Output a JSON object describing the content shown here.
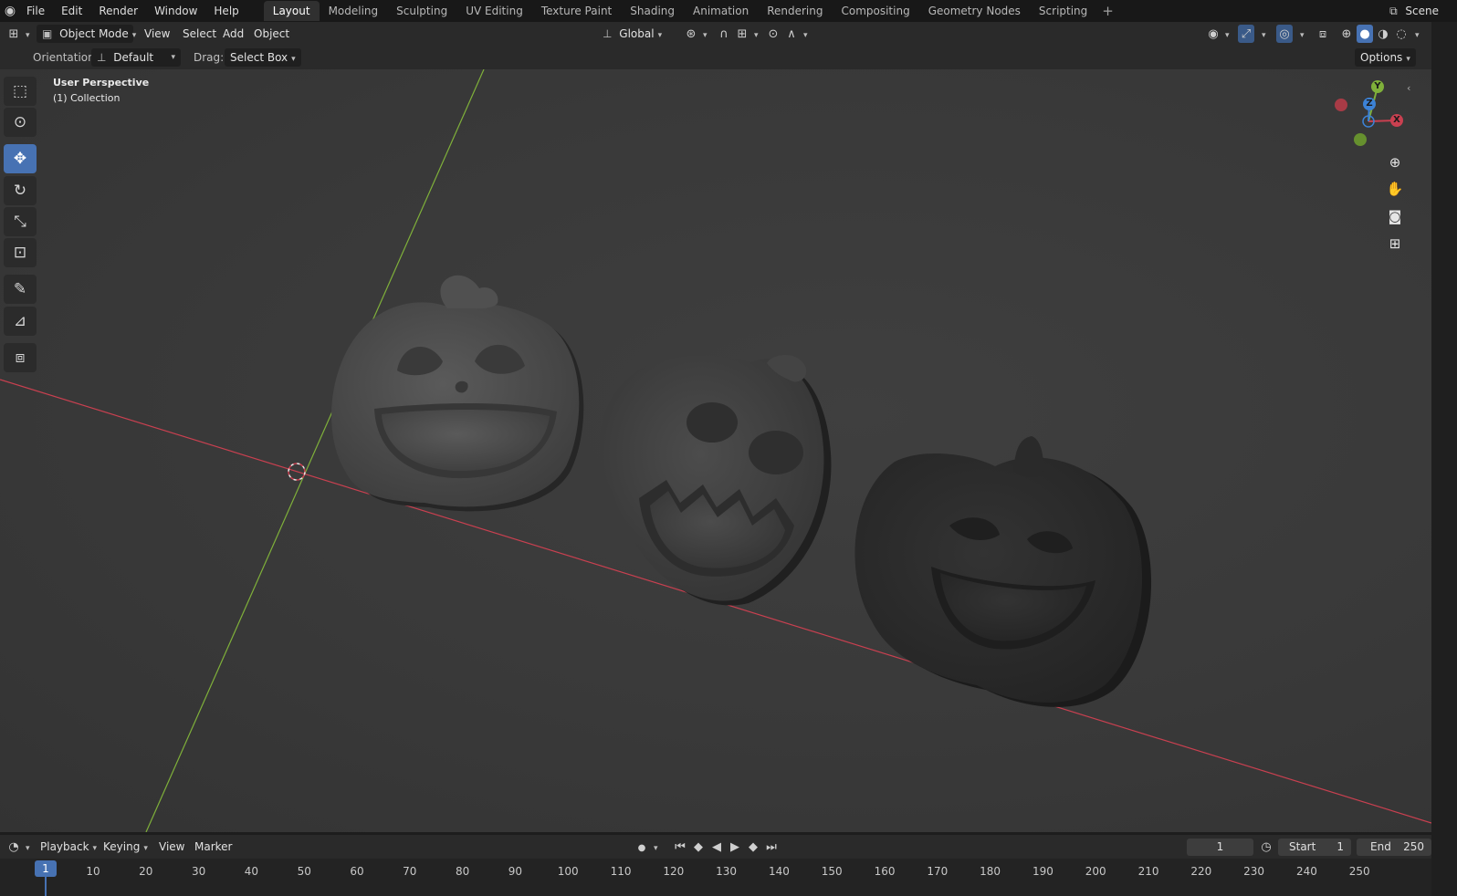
{
  "topbar": {
    "menus": [
      "File",
      "Edit",
      "Render",
      "Window",
      "Help"
    ],
    "workspaces": [
      "Layout",
      "Modeling",
      "Sculpting",
      "UV Editing",
      "Texture Paint",
      "Shading",
      "Animation",
      "Rendering",
      "Compositing",
      "Geometry Nodes",
      "Scripting"
    ],
    "active_workspace": "Layout",
    "add_tab": "+",
    "scene_label": "Scene"
  },
  "header": {
    "mode": "Object Mode",
    "menus": [
      "View",
      "Select",
      "Add",
      "Object"
    ],
    "transform_orientation": "Global",
    "options_label": "Options",
    "orientation_label": "Orientation:",
    "orientation_value": "Default",
    "drag_label": "Drag:",
    "drag_value": "Select Box"
  },
  "viewport": {
    "perspective_label": "User Perspective",
    "collection_label": "(1) Collection",
    "gizmo_axes": [
      "Y",
      "Z",
      "X"
    ],
    "colors": {
      "x_axis": "#c94050",
      "y_axis": "#7fb03a",
      "z_axis": "#3c82d6"
    }
  },
  "toolbar": {
    "tools": [
      "select-box-icon",
      "cursor-icon",
      "move-icon",
      "rotate-icon",
      "scale-icon",
      "transform-icon",
      "annotate-icon",
      "measure-icon",
      "add-cube-icon"
    ],
    "active_tool": "move-icon"
  },
  "navigation": [
    "zoom-icon",
    "pan-hand-icon",
    "camera-icon",
    "grid-view-icon"
  ],
  "timeline": {
    "menus": [
      "Playback",
      "Keying",
      "View",
      "Marker"
    ],
    "current_frame": "1",
    "start_label": "Start",
    "start_value": "1",
    "end_label": "End",
    "end_value": "250",
    "ruler_current": "1",
    "ruler_ticks": [
      "10",
      "20",
      "30",
      "40",
      "50",
      "60",
      "70",
      "80",
      "90",
      "100",
      "110",
      "120",
      "130",
      "140",
      "150",
      "160",
      "170",
      "180",
      "190",
      "200",
      "210",
      "220",
      "230",
      "240",
      "250"
    ]
  }
}
